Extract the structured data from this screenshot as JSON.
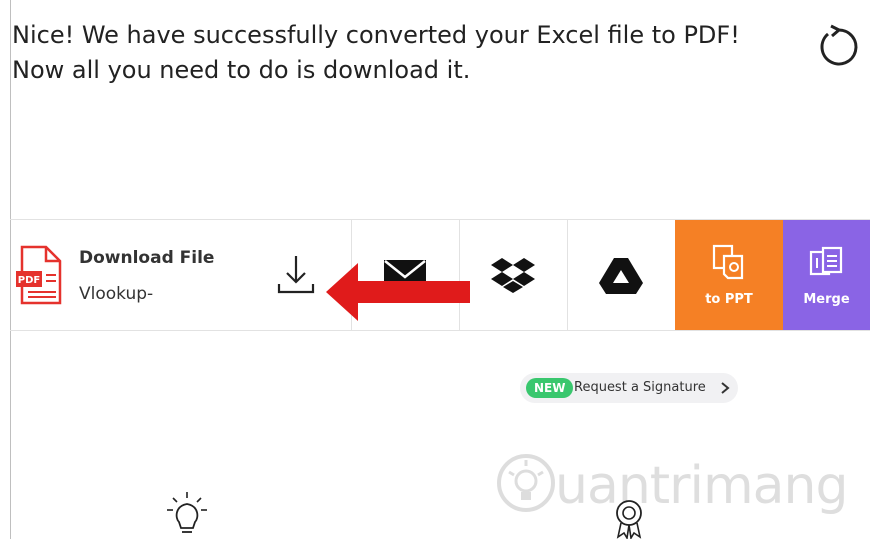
{
  "message": "Nice! We have successfully converted your Excel file to PDF! Now all you need to do is download it.",
  "file": {
    "title": "Download File",
    "name": "Vlookup-",
    "pdf_badge": "PDF"
  },
  "tiles": {
    "to_ppt": "to PPT",
    "merge": "Merge"
  },
  "signature": {
    "badge": "NEW",
    "label": "Request a Signature"
  },
  "watermark": "uantrimang",
  "colors": {
    "orange": "#f58025",
    "purple": "#8a64e5",
    "new_badge": "#39c76e",
    "arrow": "#e01b1b",
    "pdf_red": "#e5322d"
  },
  "icons": [
    "restart-icon",
    "pdf-file-icon",
    "download-icon",
    "email-icon",
    "dropbox-icon",
    "google-drive-icon",
    "ppt-icon",
    "merge-icon",
    "chevron-right-icon",
    "lightbulb-icon",
    "medal-icon"
  ]
}
